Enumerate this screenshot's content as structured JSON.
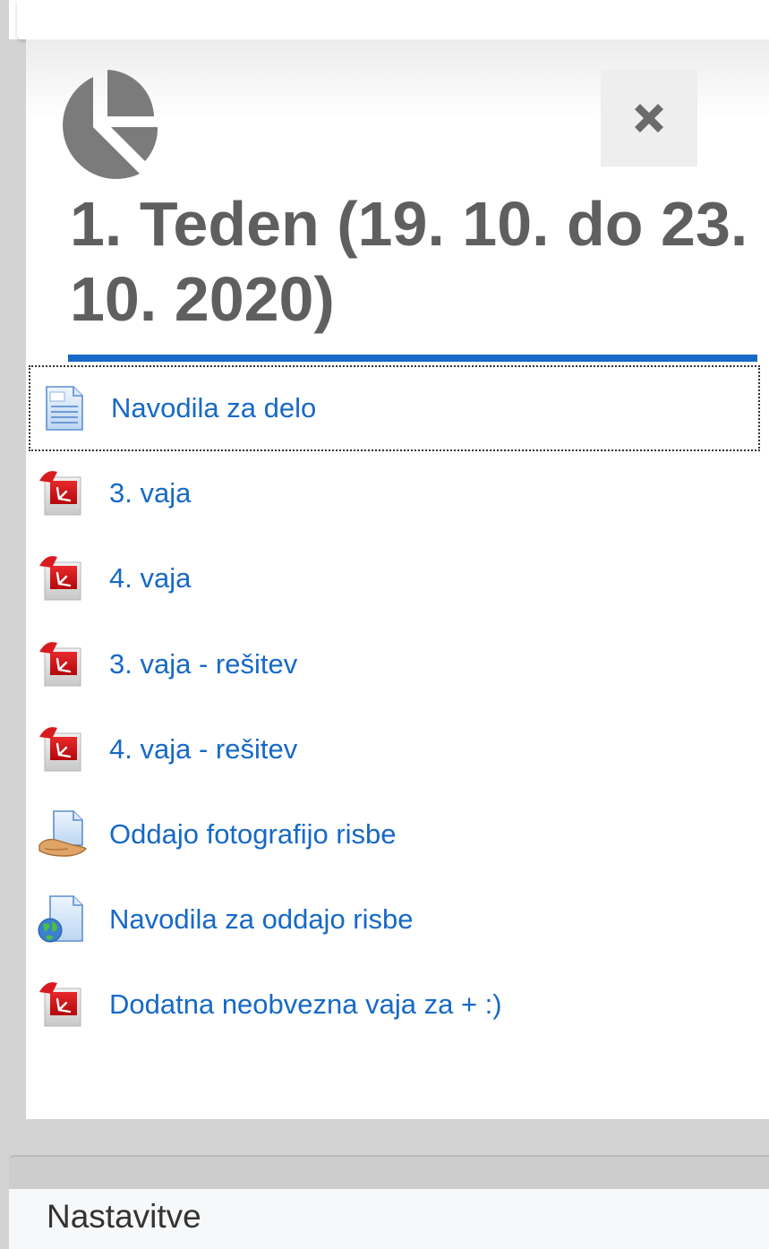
{
  "section": {
    "title": "1. Teden (19. 10. do 23. 10. 2020)",
    "icon": "pie-chart-icon",
    "close_icon": "close-icon"
  },
  "activities": [
    {
      "label": "Navodila za delo",
      "icon": "page-icon"
    },
    {
      "label": "3. vaja",
      "icon": "pdf-icon"
    },
    {
      "label": "4. vaja",
      "icon": "pdf-icon"
    },
    {
      "label": "3. vaja - rešitev",
      "icon": "pdf-icon"
    },
    {
      "label": "4. vaja - rešitev",
      "icon": "pdf-icon"
    },
    {
      "label": "Oddajo fotografijo risbe",
      "icon": "assignment-icon"
    },
    {
      "label": "Navodila za oddajo risbe",
      "icon": "url-icon"
    },
    {
      "label": "Dodatna neobvezna vaja za + :)",
      "icon": "pdf-icon"
    }
  ],
  "footer": {
    "settings_label": "Nastavitve"
  },
  "colors": {
    "link": "#1669c7",
    "title": "#5f5f5f",
    "underline": "#1669c7"
  }
}
